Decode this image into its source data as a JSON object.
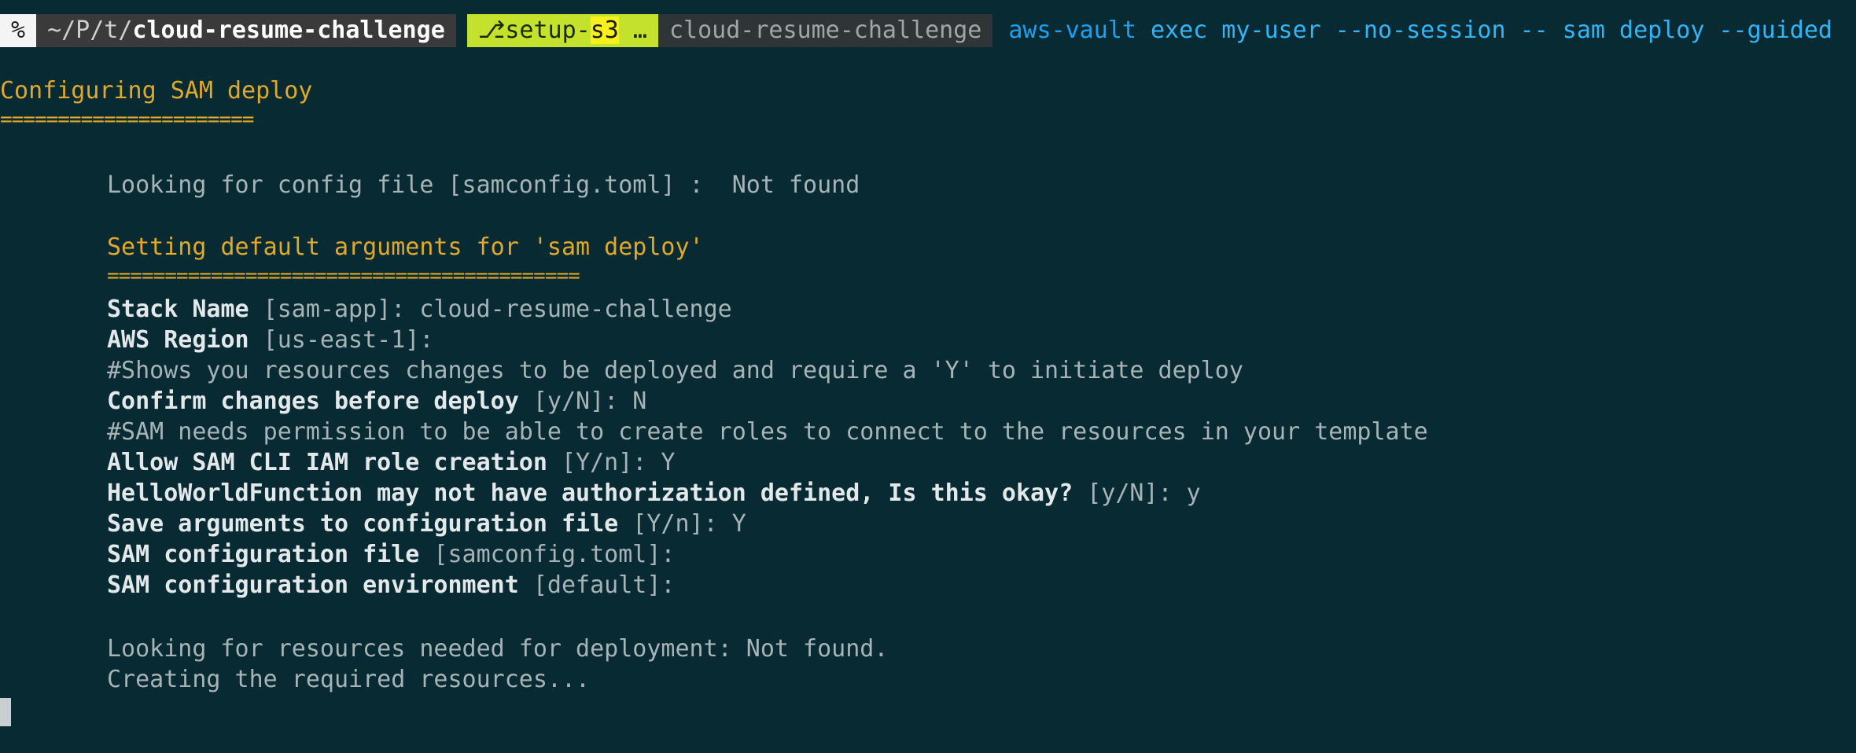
{
  "prompt": {
    "symbol": "%",
    "path_prefix": "~/P/t/",
    "path_dir": "cloud-resume-challenge",
    "branch_icon": "branch-icon",
    "branch_glyph": "⎇",
    "branch_name_a": "setup-",
    "branch_name_b": "s3",
    "branch_ellipsis": " …",
    "dir_label": "cloud-resume-challenge",
    "command_bin": "aws-vault",
    "command_args": " exec my-user --no-session -- sam deploy --guided"
  },
  "output": {
    "section1_title": "Configuring SAM deploy",
    "section1_underline": "======================",
    "config_lookup": "Looking for config file [samconfig.toml] :  Not found",
    "section2_title": "Setting default arguments for 'sam deploy'",
    "section2_underline": "=========================================",
    "q_stack_name": "Stack Name",
    "q_stack_name_rest": " [sam-app]: cloud-resume-challenge",
    "q_region": "AWS Region",
    "q_region_rest": " [us-east-1]:",
    "comment_confirm": "#Shows you resources changes to be deployed and require a 'Y' to initiate deploy",
    "q_confirm": "Confirm changes before deploy",
    "q_confirm_rest": " [y/N]: N",
    "comment_iam": "#SAM needs permission to be able to create roles to connect to the resources in your template",
    "q_iam": "Allow SAM CLI IAM role creation",
    "q_iam_rest": " [Y/n]: Y",
    "q_auth": "HelloWorldFunction may not have authorization defined, Is this okay?",
    "q_auth_rest": " [y/N]: y",
    "q_save": "Save arguments to configuration file",
    "q_save_rest": " [Y/n]: Y",
    "q_config_file": "SAM configuration file",
    "q_config_file_rest": " [samconfig.toml]:",
    "q_config_env": "SAM configuration environment",
    "q_config_env_rest": " [default]:",
    "resources_lookup": "Looking for resources needed for deployment: Not found.",
    "creating": "Creating the required resources..."
  },
  "colors": {
    "background": "#082a33",
    "accent_yellow": "#e0a92a",
    "command_blue": "#1e9ff2",
    "branch_green": "#c4e22d"
  }
}
